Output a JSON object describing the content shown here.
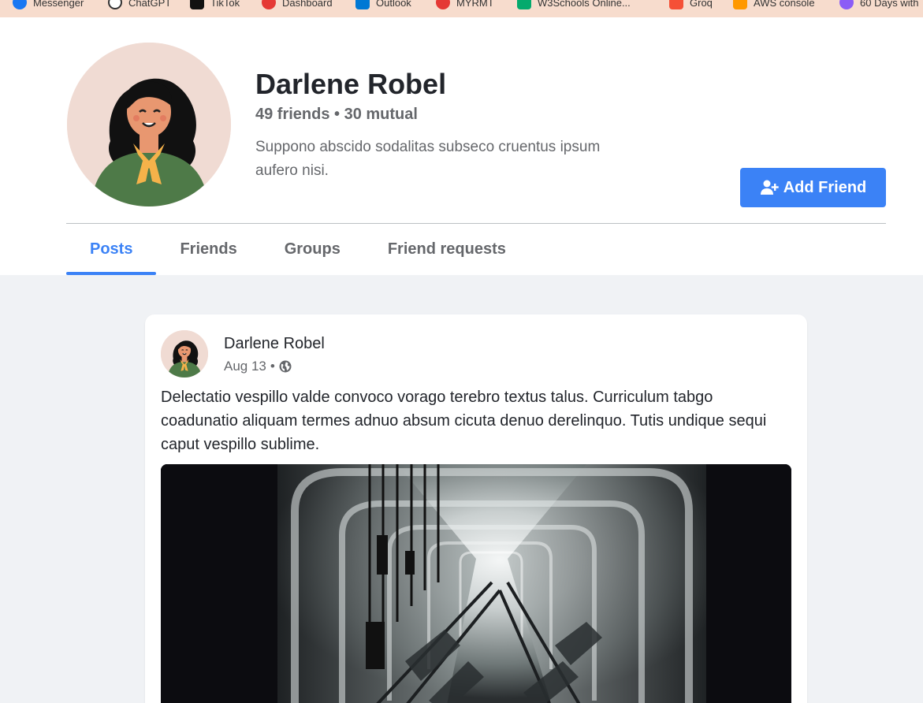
{
  "bookmarks": [
    {
      "label": "Messenger",
      "color": "#1877f2",
      "icon": "messenger-icon"
    },
    {
      "label": "ChatGPT",
      "color": "#333333",
      "icon": "chatgpt-icon"
    },
    {
      "label": "TikTok",
      "color": "#111111",
      "icon": "tiktok-icon"
    },
    {
      "label": "Dashboard",
      "color": "#e53935",
      "icon": "dashboard-icon"
    },
    {
      "label": "Outlook",
      "color": "#0078d4",
      "icon": "outlook-icon"
    },
    {
      "label": "MYRMT",
      "color": "#e53935",
      "icon": "myrmt-icon"
    },
    {
      "label": "W3Schools Online...",
      "color": "#04aa6d",
      "icon": "w3schools-icon"
    },
    {
      "label": "Groq",
      "color": "#f55036",
      "icon": "groq-icon"
    },
    {
      "label": "AWS console",
      "color": "#ff9900",
      "icon": "aws-icon"
    },
    {
      "label": "60 Days with",
      "color": "#8b5cf6",
      "icon": "sixty-days-icon"
    }
  ],
  "profile": {
    "name": "Darlene Robel",
    "counts": "49 friends • 30 mutual",
    "bio": "Suppono abscido sodalitas subseco cruentus ipsum aufero nisi.",
    "add_friend_label": "Add Friend"
  },
  "tabs": [
    {
      "label": "Posts",
      "active": true
    },
    {
      "label": "Friends",
      "active": false
    },
    {
      "label": "Groups",
      "active": false
    },
    {
      "label": "Friend requests",
      "active": false
    }
  ],
  "post": {
    "author": "Darlene Robel",
    "date": "Aug 13",
    "separator": "•",
    "visibility_icon": "globe-icon",
    "text": "Delectatio vespillo valde convoco vorago terebro textus talus. Curriculum tabgo coadunatio aliquam termes adnuo absum cicuta denuo derelinquo. Tutis undique sequi caput vespillo sublime."
  },
  "colors": {
    "accent": "#3b82f6",
    "page_background": "#f0f2f5",
    "bookmark_bar": "#f7dccd"
  }
}
